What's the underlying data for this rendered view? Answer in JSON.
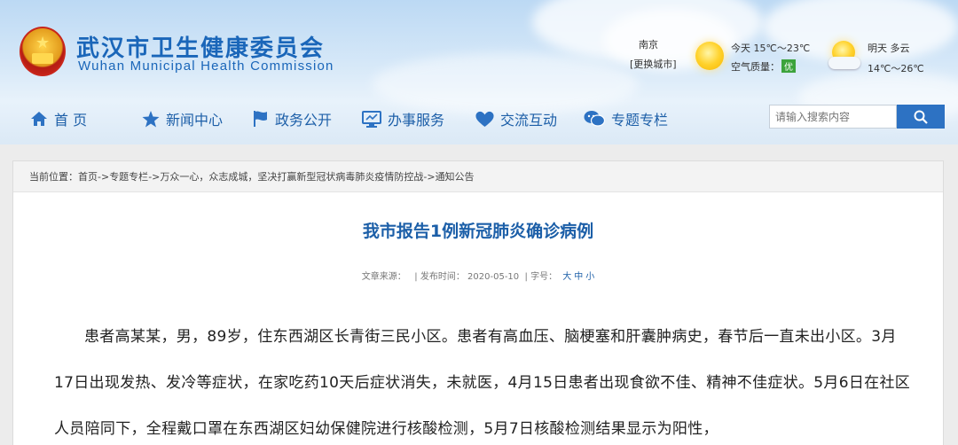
{
  "header": {
    "title_cn": "武汉市卫生健康委员会",
    "title_en": "Wuhan Municipal Health Commission"
  },
  "weather": {
    "city": "南京",
    "change_city": "[更换城市]",
    "today": "今天  15℃～23℃",
    "air_quality_label": "空气质量：",
    "air_quality_value": "优",
    "tomorrow": "明天  多云",
    "tomorrow_temp": "14℃～26℃",
    "colors": {
      "aq_badge": "#3ca33c"
    }
  },
  "nav": {
    "items": [
      {
        "label": "首  页",
        "icon": "home-icon"
      },
      {
        "label": "新闻中心",
        "icon": "star-icon"
      },
      {
        "label": "政务公开",
        "icon": "flag-icon"
      },
      {
        "label": "办事服务",
        "icon": "monitor-icon"
      },
      {
        "label": "交流互动",
        "icon": "heart-icon"
      },
      {
        "label": "专题专栏",
        "icon": "chat-icon"
      }
    ]
  },
  "search": {
    "placeholder": "请输入搜索内容",
    "icon": "search-icon"
  },
  "breadcrumb": {
    "prefix": "当前位置：",
    "items": [
      "首页",
      "专题专栏",
      "万众一心，众志成城，坚决打赢新型冠状病毒肺炎疫情防控战",
      "通知公告"
    ],
    "separator": "->"
  },
  "article": {
    "title": "我市报告1例新冠肺炎确诊病例",
    "source_label": "文章来源：",
    "date_label": "| 发布时间：",
    "date": "2020-05-10",
    "font_label": "| 字号：",
    "font_sizes": [
      "大",
      "中",
      "小"
    ],
    "body": "患者高某某，男，89岁，住东西湖区长青街三民小区。患者有高血压、脑梗塞和肝囊肿病史，春节后一直未出小区。3月17日出现发热、发冷等症状，在家吃药10天后症状消失，未就医，4月15日患者出现食欲不佳、精神不佳症状。5月6日在社区人员陪同下，全程戴口罩在东西湖区妇幼保健院进行核酸检测，5月7日核酸检测结果显示为阳性，"
  },
  "colors": {
    "brand_blue": "#1a66b9",
    "search_button": "#2d72c3"
  }
}
